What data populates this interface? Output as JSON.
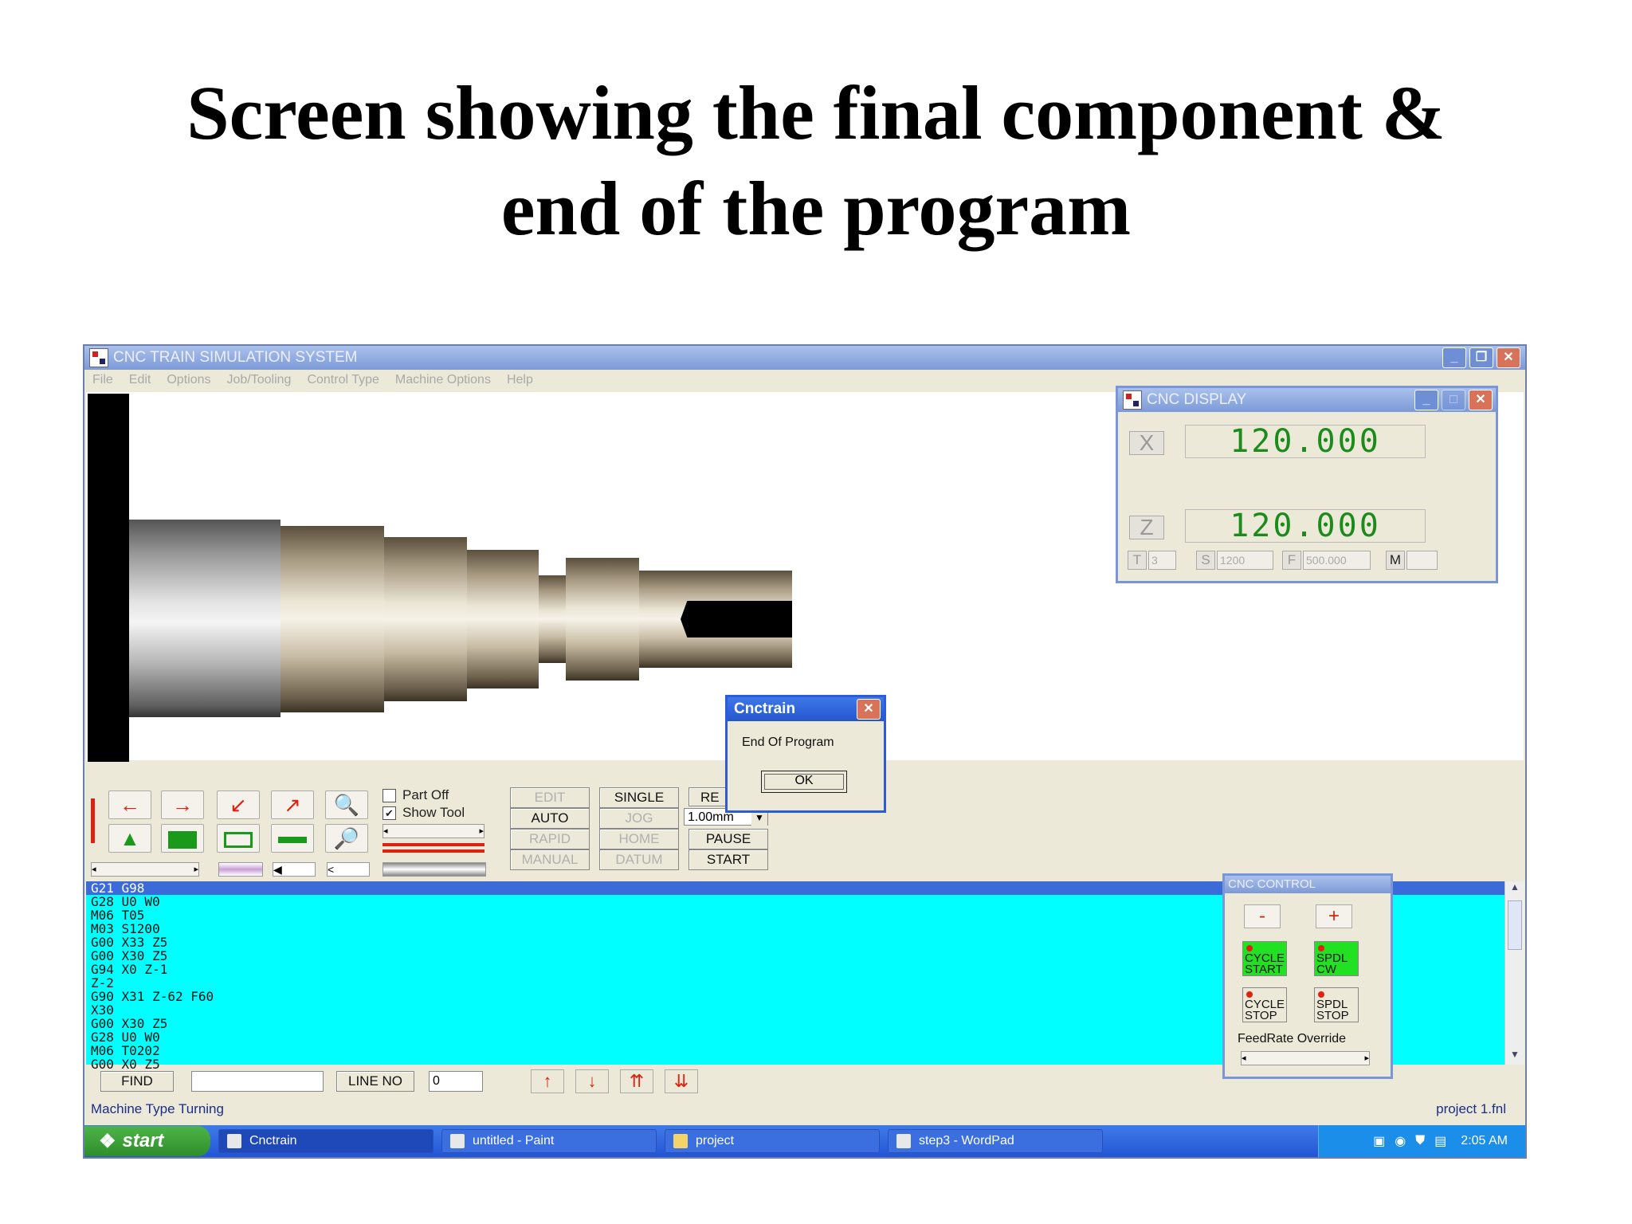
{
  "slide": {
    "title_line1": "Screen showing the final component &",
    "title_line2": "end of the program"
  },
  "window": {
    "title": "CNC TRAIN SIMULATION SYSTEM",
    "menu": [
      "File",
      "Edit",
      "Options",
      "Job/Tooling",
      "Control Type",
      "Machine Options",
      "Help"
    ]
  },
  "controls": {
    "part_off": "Part Off",
    "show_tool": "Show Tool",
    "modes": {
      "edit": "EDIT",
      "single": "SINGLE",
      "reset": "RE",
      "auto": "AUTO",
      "jog": "JOG",
      "step": "1.00mm",
      "rapid": "RAPID",
      "home": "HOME",
      "pause": "PAUSE",
      "manual": "MANUAL",
      "datum": "DATUM",
      "start": "START"
    }
  },
  "program": {
    "lines": [
      "G21 G98",
      "G28 U0 W0",
      "M06 T05",
      "M03 S1200",
      "G00 X33 Z5",
      "G00 X30 Z5",
      "G94 X0 Z-1",
      "Z-2",
      "G90 X31 Z-62 F60",
      "X30",
      "G00 X30 Z5",
      "G28 U0 W0",
      "M06 T0202",
      "G00 X0 Z5"
    ]
  },
  "findbar": {
    "find_label": "FIND",
    "line_no_label": "LINE NO",
    "line_no_value": "0"
  },
  "status": {
    "machine_type": "Machine Type  Turning",
    "file": "project 1.fnl"
  },
  "taskbar": {
    "start": "start",
    "tasks": [
      "Cnctrain",
      "untitled - Paint",
      "project",
      "step3 - WordPad"
    ],
    "clock": "2:05 AM"
  },
  "display": {
    "title": "CNC DISPLAY",
    "x_label": "X",
    "x_value": "120.000",
    "z_label": "Z",
    "z_value": "120.000",
    "t_label": "T",
    "t_value": "3",
    "s_label": "S",
    "s_value": "1200",
    "f_label": "F",
    "f_value": "500.000",
    "m_label": "M",
    "m_value": ""
  },
  "cnc_control": {
    "title": "CNC CONTROL",
    "minus": "-",
    "plus": "+",
    "cycle_start": [
      "CYCLE",
      "START"
    ],
    "spdl_cw": [
      "SPDL",
      "CW"
    ],
    "cycle_stop": [
      "CYCLE",
      "STOP"
    ],
    "spdl_stop": [
      "SPDL",
      "STOP"
    ],
    "feedrate_label": "FeedRate Override"
  },
  "dialog": {
    "title": "Cnctrain",
    "message": "End Of Program",
    "ok": "OK"
  },
  "colors": {
    "program_bg": "#00ffff",
    "readout_text": "#1b8c1b",
    "selected_line": "#3c6ad8"
  }
}
